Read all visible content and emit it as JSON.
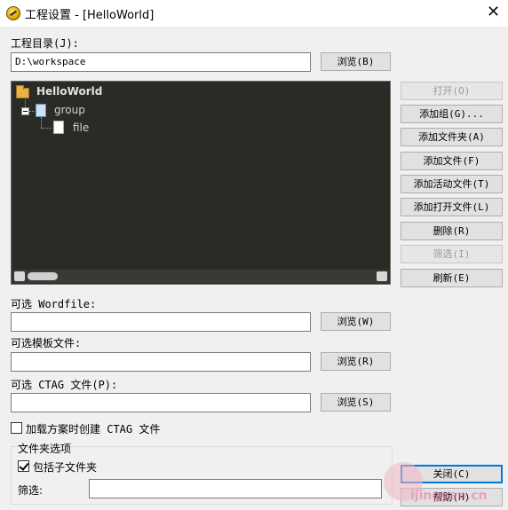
{
  "window": {
    "title": "工程设置 - [HelloWorld]"
  },
  "project_dir": {
    "label": "工程目录(J):",
    "value": "D:\\workspace",
    "browse": "浏览(B)"
  },
  "tree": {
    "root": "HelloWorld",
    "group": "group",
    "file": "file"
  },
  "actions": {
    "open": "打开(O)",
    "add_group": "添加组(G)...",
    "add_folder": "添加文件夹(A)",
    "add_file": "添加文件(F)",
    "add_active_file": "添加活动文件(T)",
    "add_open_files": "添加打开文件(L)",
    "delete": "删除(R)",
    "filter": "筛选(I)",
    "refresh": "刷新(E)"
  },
  "wordfile": {
    "label": "可选 Wordfile:",
    "value": "",
    "browse": "浏览(W)"
  },
  "template": {
    "label": "可选模板文件:",
    "value": "",
    "browse": "浏览(R)"
  },
  "ctag": {
    "label": "可选 CTAG 文件(P):",
    "value": "",
    "browse": "浏览(S)"
  },
  "create_ctag": {
    "label": "加载方案时创建 CTAG 文件",
    "checked": false
  },
  "folder_options": {
    "title": "文件夹选项",
    "include_subfolders": {
      "label": "包括子文件夹",
      "checked": true
    },
    "filter_label": "筛选:",
    "filter_value": ""
  },
  "footer": {
    "close": "关闭(C)",
    "help": "帮助(H)"
  },
  "watermark_text": "ijingyan.cn"
}
